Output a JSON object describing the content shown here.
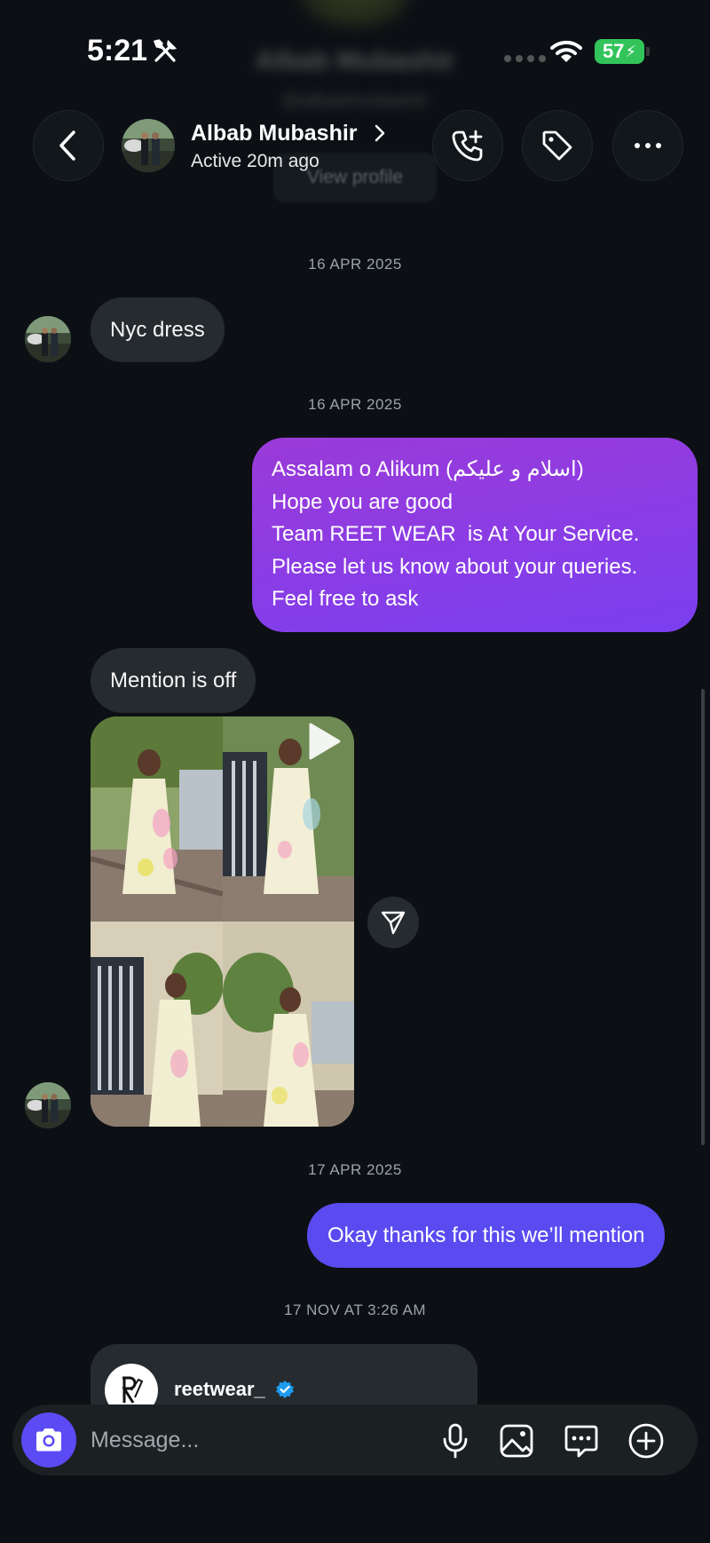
{
  "status_bar": {
    "time": "5:21",
    "battery": "57"
  },
  "background_profile": {
    "name": "Albab Mubashir",
    "handle": "@albabmubashir"
  },
  "header": {
    "contact_name": "Albab Mubashir",
    "contact_status": "Active 20m ago",
    "view_profile_label": "View profile"
  },
  "messages": {
    "date_1": "16 APR 2025",
    "incoming_1": "Nyc dress",
    "date_2": "16 APR 2025",
    "outgoing_1_lines": [
      "Assalam o Alikum (اسلام و علیکم)",
      "Hope you are good",
      "Team REET WEAR  is At Your Service.",
      "Please let us know about your queries.",
      "Feel free to ask"
    ],
    "incoming_2": "Mention is off",
    "date_3": "17 APR 2025",
    "outgoing_2": "Okay thanks for this we’ll mention",
    "date_4": "17 NOV AT 3:26 AM"
  },
  "card": {
    "account_name": "reetwear_"
  },
  "composer": {
    "placeholder": "Message..."
  },
  "colors": {
    "background": "#0c1014",
    "incoming_bubble": "#262b30",
    "outgoing_bubble_purple": "#9b3ad8",
    "outgoing_bubble_blue": "#5a4bf0",
    "battery_green": "#32c45a",
    "verified_blue": "#1d9bf0"
  }
}
